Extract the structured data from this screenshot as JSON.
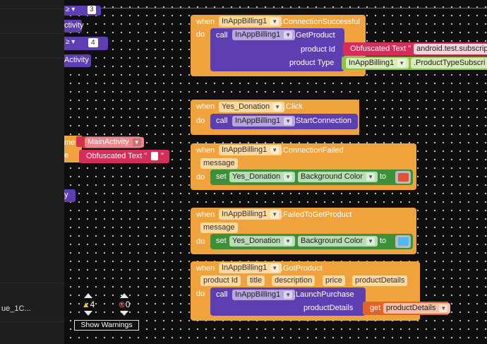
{
  "left_panel": {
    "item": "ue_1C..."
  },
  "left_blocks": {
    "compare_op_1": "≥ ▾",
    "compare_num_1": "3",
    "activity_1": "ctivity",
    "compare_op_2": "≥ ▾",
    "compare_num_2": "4",
    "activity_2": "Activity",
    "name_label": "me",
    "value_label": "e",
    "main_activity": "MainActivity",
    "obfuscated": "Obfuscated Text \"",
    "obf_close": "\"",
    "y_block": "y"
  },
  "blocks": {
    "conn_success": {
      "when": "when",
      "component": "InAppBilling1",
      "event": ".ConnectionSuccessful",
      "do": "do",
      "call": "call",
      "call_component": "InAppBilling1",
      "method": ".GetProduct",
      "param1": "product Id",
      "param2": "product Type",
      "obf_text": "Obfuscated Text \"",
      "product_id_value": "android.test.subscrip",
      "type_component": "InAppBilling1",
      "type_value": ".ProductTypeSubscri"
    },
    "yes_click": {
      "when": "when",
      "component": "Yes_Donation",
      "event": ".Click",
      "do": "do",
      "call": "call",
      "call_component": "InAppBilling1",
      "method": ".StartConnection"
    },
    "conn_failed": {
      "when": "when",
      "component": "InAppBilling1",
      "event": ".ConnectionFailed",
      "param": "message",
      "do": "do",
      "set": "set",
      "set_component": "Yes_Donation",
      "property": "Background Color",
      "to": "to",
      "color": "#e0533a"
    },
    "failed_get": {
      "when": "when",
      "component": "InAppBilling1",
      "event": ".FailedToGetProduct",
      "param": "message",
      "do": "do",
      "set": "set",
      "set_component": "Yes_Donation",
      "property": "Background Color",
      "to": "to",
      "color": "#4fb8f0"
    },
    "got_product": {
      "when": "when",
      "component": "InAppBilling1",
      "event": ".GotProduct",
      "params": [
        "product Id",
        "title",
        "description",
        "price",
        "productDetails"
      ],
      "do": "do",
      "call": "call",
      "call_component": "InAppBilling1",
      "method": ".LaunchPurchase",
      "param": "productDetails",
      "get": "get",
      "get_var": "productDetails"
    }
  },
  "warnings": {
    "warning_count": "4",
    "error_count": "0",
    "show_warnings": "Show Warnings"
  }
}
